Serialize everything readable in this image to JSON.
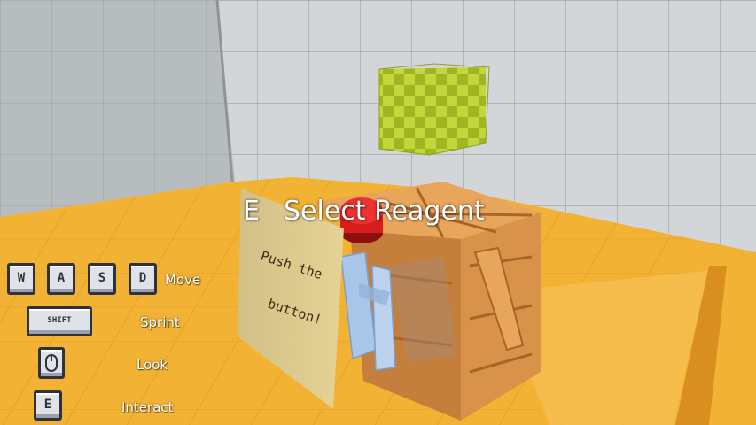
{
  "prompt": {
    "key": "E",
    "action": "Select Reagent"
  },
  "note": {
    "line1": "Push the",
    "line2": "button!"
  },
  "controls": [
    {
      "keys": [
        "W",
        "A",
        "S",
        "D"
      ],
      "label": "Move"
    },
    {
      "keys": [
        "SHIFT"
      ],
      "label": "Sprint"
    },
    {
      "keys": [
        "mouse"
      ],
      "label": "Look"
    },
    {
      "keys": [
        "E"
      ],
      "label": "Interact"
    }
  ],
  "icons": {
    "mouse": "mouse-icon"
  },
  "colors": {
    "floor": "#f2b233",
    "crate": "#d9924a",
    "cube": "#b6cc2c",
    "button": "#d91d1d",
    "note": "#e6d294",
    "glass": "#a9c6e8"
  }
}
